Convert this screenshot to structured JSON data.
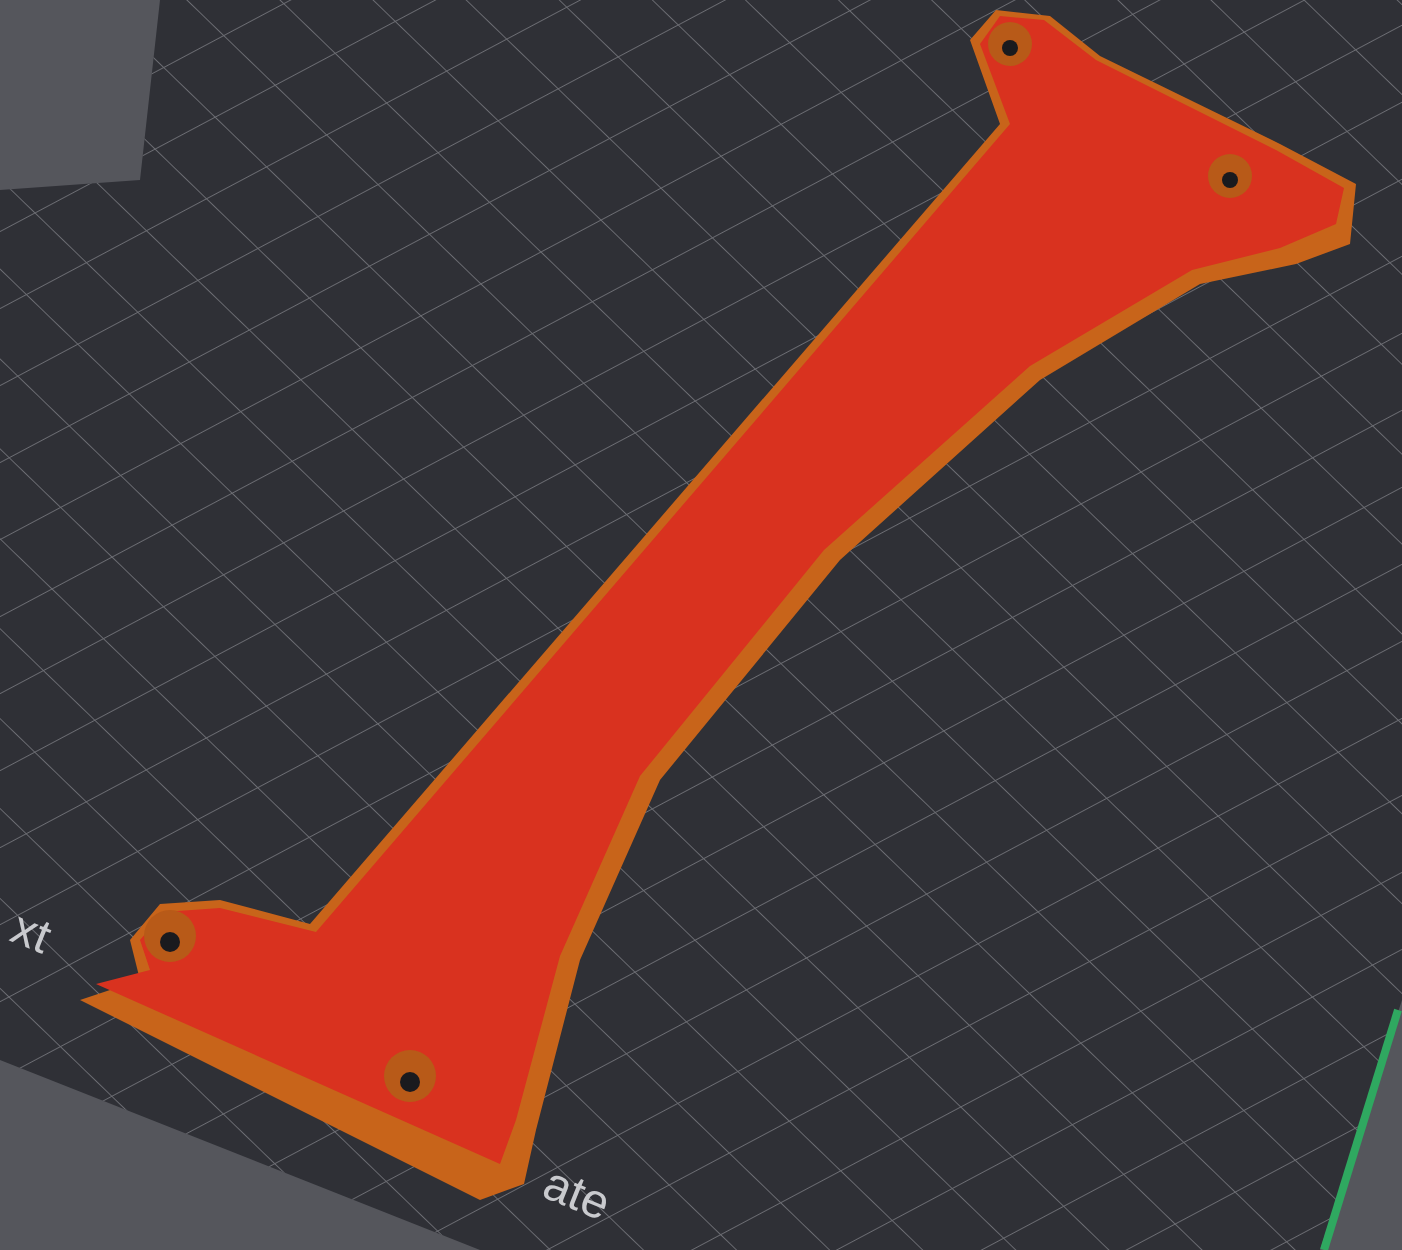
{
  "bed": {
    "labels": [
      "xt",
      "ate"
    ]
  }
}
